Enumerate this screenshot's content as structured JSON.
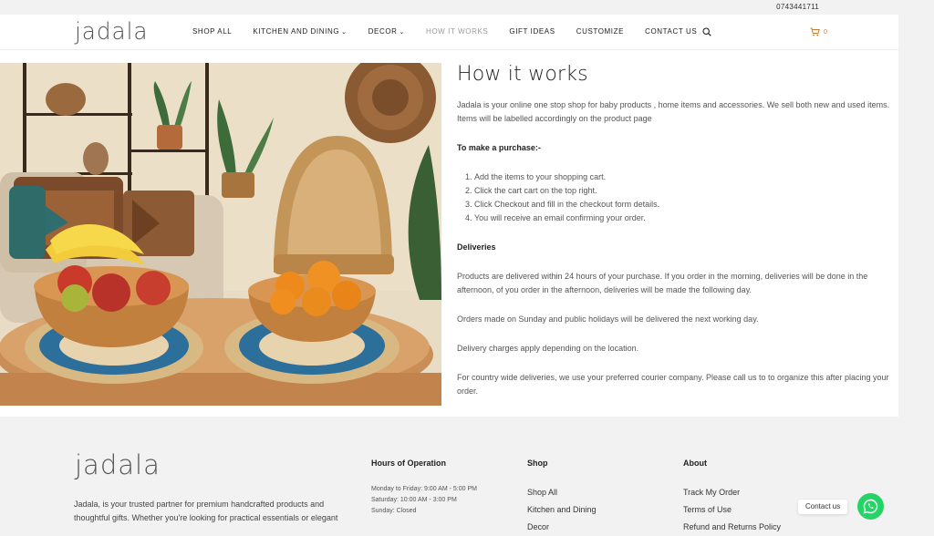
{
  "topbar": {
    "phone": "0743441711"
  },
  "header": {
    "logo": "jadala",
    "nav": [
      {
        "label": "SHOP ALL",
        "dropdown": false,
        "active": false
      },
      {
        "label": "KITCHEN AND DINING",
        "dropdown": true,
        "active": false
      },
      {
        "label": "DECOR",
        "dropdown": true,
        "active": false
      },
      {
        "label": "HOW IT WORKS",
        "dropdown": false,
        "active": true
      },
      {
        "label": "GIFT IDEAS",
        "dropdown": false,
        "active": false
      },
      {
        "label": "CUSTOMIZE",
        "dropdown": false,
        "active": false
      },
      {
        "label": "CONTACT US",
        "dropdown": false,
        "active": false
      }
    ],
    "search_icon": "search-icon",
    "cart": {
      "icon": "cart-icon",
      "count": "0"
    }
  },
  "hero": {
    "image": "living-room-fruit-bowls"
  },
  "content": {
    "title": "How it works",
    "intro": "Jadala is your online one stop shop for baby products , home items and accessories. We sell both new and used items. Items will be labelled accordingly on the product page",
    "purchase_heading": "To make a purchase:-",
    "steps": [
      "Add the items to your shopping cart.",
      "Click the cart cart on the top right.",
      "Click Checkout and fill in the checkout form details.",
      "You will receive an email confirming your order."
    ],
    "deliveries_heading": "Deliveries",
    "deliveries": [
      "Products are delivered within 24 hours of your purchase. If you order in the morning, deliveries will be done in the afternoon, of you order in the afternoon, deliveries will be made the following day.",
      "Orders made on Sunday and public holidays will be delivered the next working day.",
      "Delivery charges apply depending on the location.",
      "For country wide deliveries, we use your preferred courier company. Please call us to to organize this  after placing your order."
    ]
  },
  "footer": {
    "logo": "jadala",
    "description": "Jadala, is your trusted partner for premium handcrafted products and thoughtful gifts. Whether you're looking for practical essentials or elegant",
    "hours": {
      "heading": "Hours of Operation",
      "lines": [
        "Monday to Friday: 9:00 AM - 5:00 PM",
        "Saturday: 10:00 AM - 3:00 PM",
        "Sunday: Closed"
      ]
    },
    "shop": {
      "heading": "Shop",
      "links": [
        "Shop All",
        "Kitchen and Dining",
        "Decor"
      ]
    },
    "about": {
      "heading": "About",
      "links": [
        "Track My Order",
        "Terms of Use",
        "Refund and Returns Policy"
      ]
    }
  },
  "chat": {
    "label": "Contact us",
    "icon": "whatsapp-icon"
  },
  "colors": {
    "accent": "#c87b2e",
    "whatsapp": "#25d366"
  }
}
